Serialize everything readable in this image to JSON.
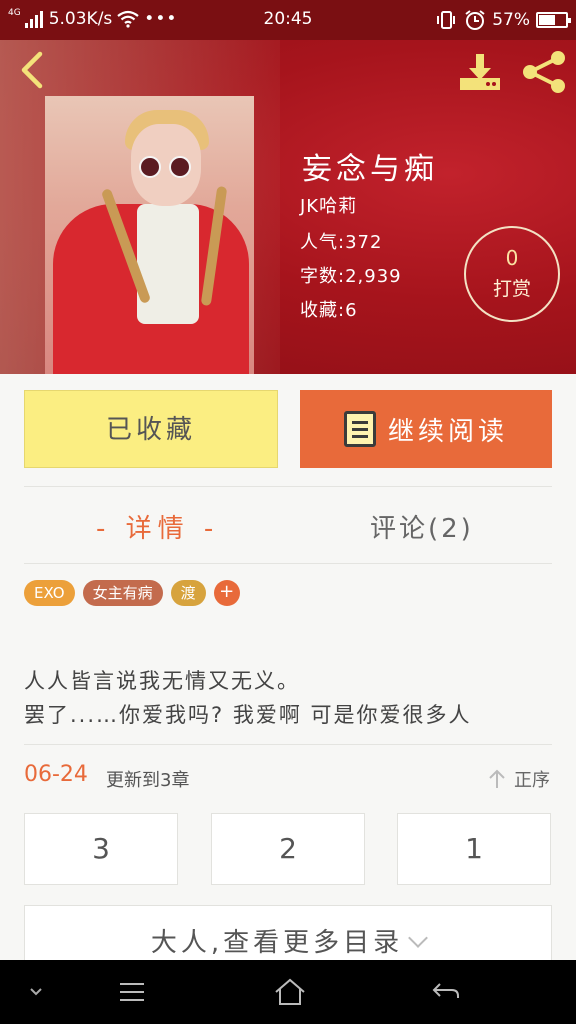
{
  "status_bar": {
    "network_type": "4G",
    "speed": "5.03K/s",
    "time": "20:45",
    "battery": "57%",
    "battery_level": 0.57,
    "icons": [
      "signal-icon",
      "wifi-icon",
      "more-dots-icon",
      "vibrate-icon",
      "alarm-icon",
      "battery-icon"
    ]
  },
  "header": {
    "back_icon": "chevron-left-icon",
    "download_icon": "download-icon",
    "share_icon": "share-icon"
  },
  "book": {
    "title": "妄念与痴",
    "author": "JK哈莉",
    "popularity": "人气:372",
    "word_count": "字数:2,939",
    "favorites": "收藏:6"
  },
  "tip": {
    "count": "0",
    "label": "打赏"
  },
  "actions": {
    "collected_label": "已收藏",
    "continue_label": "继续阅读"
  },
  "tabs": {
    "detail": "- 详情 -",
    "comments": "评论(2)"
  },
  "tags": [
    {
      "label": "EXO",
      "color": "#eca03a"
    },
    {
      "label": "女主有病",
      "color": "#c36b4d"
    },
    {
      "label": "渡",
      "color": "#d7a33d"
    }
  ],
  "tag_add_label": "+",
  "description": {
    "line1": "人人皆言说我无情又无义。",
    "line2": "罢了...…你爱我吗? 我爱啊 可是你爱很多人"
  },
  "updates": {
    "date": "06-24",
    "text": "更新到3章",
    "sort_label": "正序"
  },
  "chapters": [
    "3",
    "2",
    "1"
  ],
  "more_catalog": "大人,查看更多目录",
  "nav": {
    "icons": [
      "collapse-icon",
      "menu-icon",
      "home-icon",
      "back-icon"
    ]
  },
  "colors": {
    "accent": "#e86a3a",
    "collected_bg": "#fbee82",
    "header_red": "#a6141c"
  }
}
